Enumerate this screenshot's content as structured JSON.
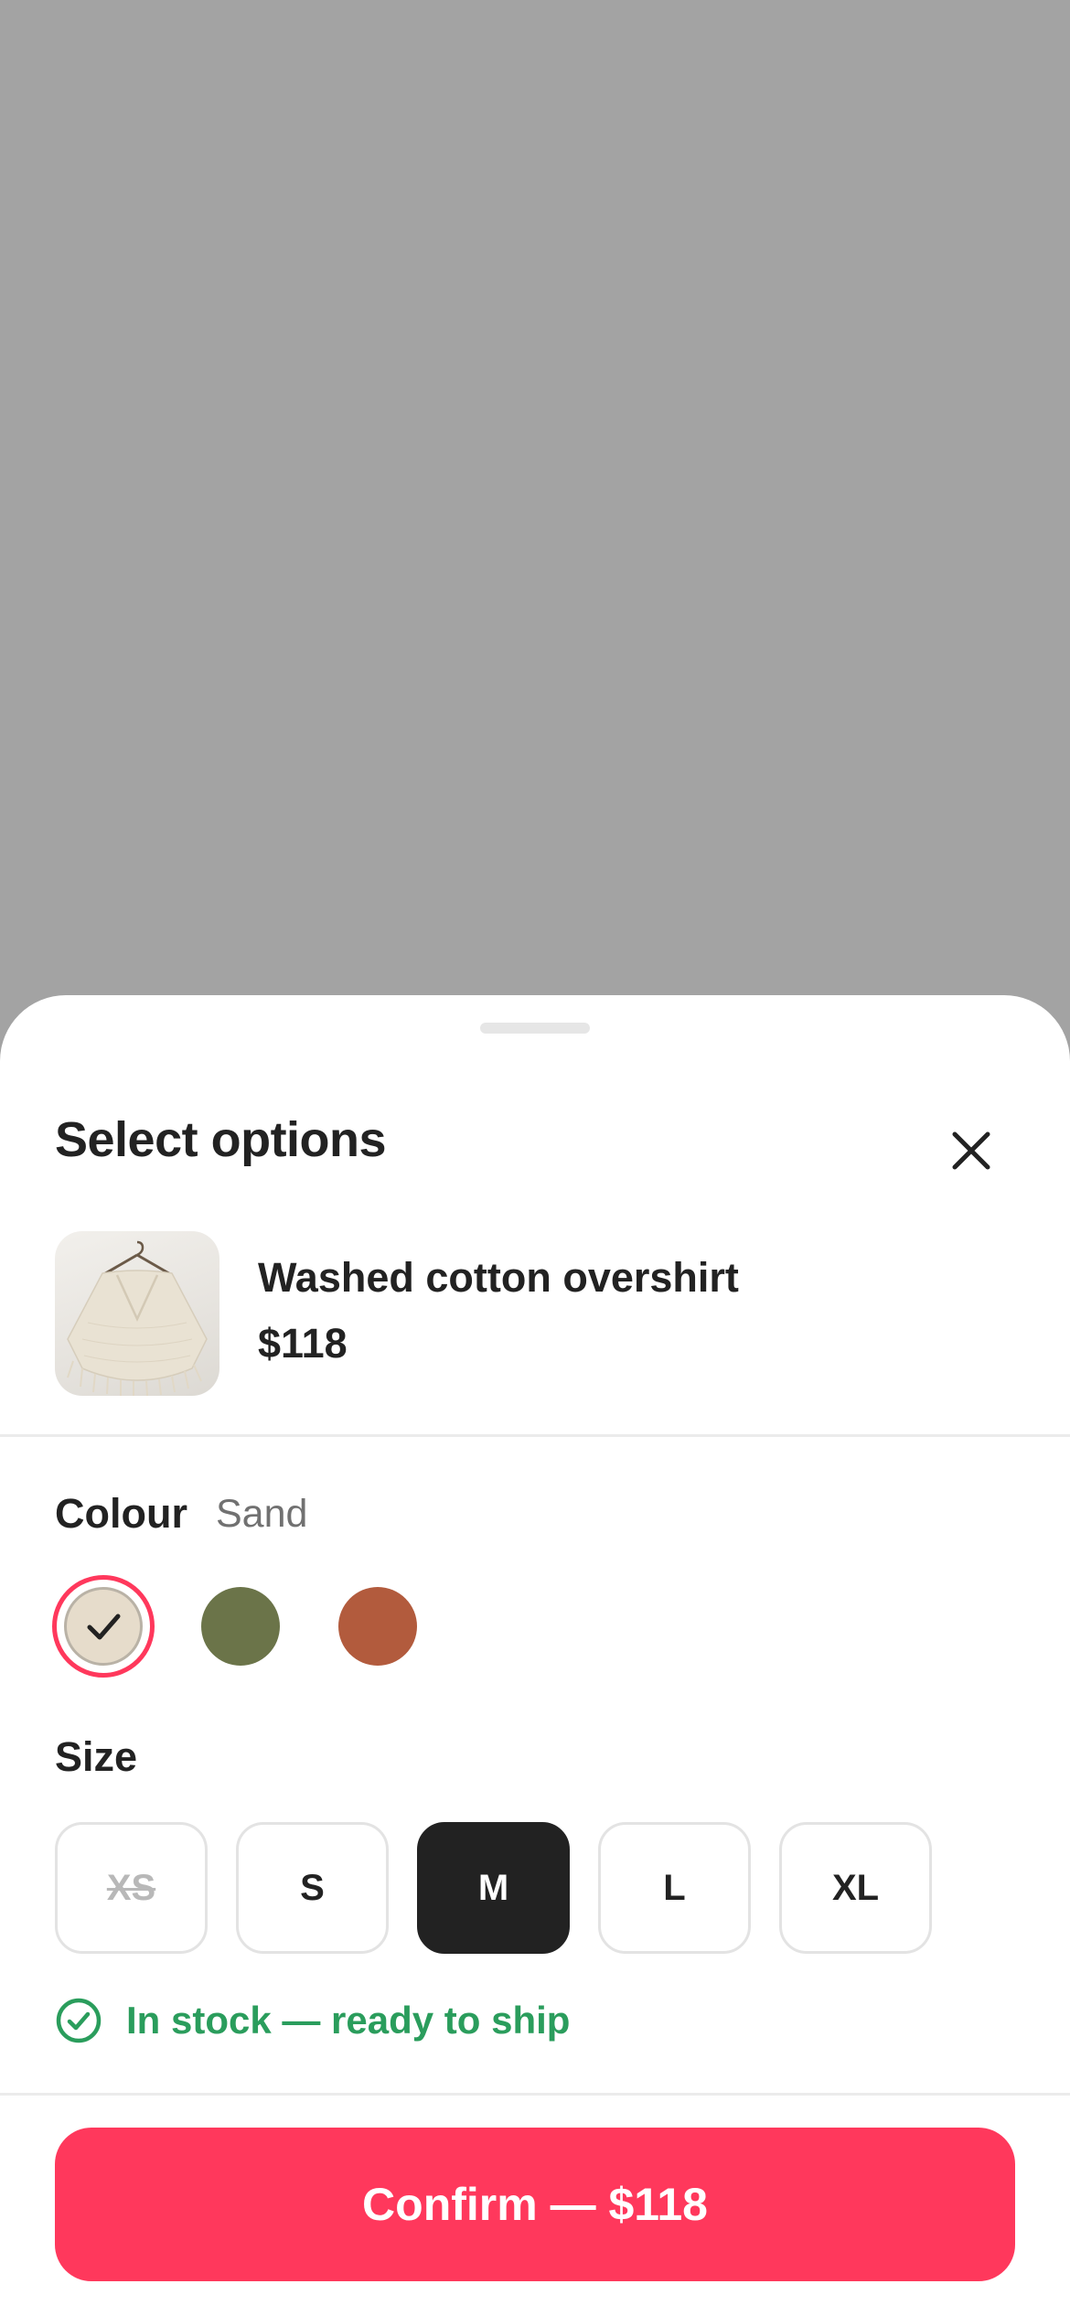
{
  "sheet": {
    "title": "Select options",
    "close_icon": "close-icon"
  },
  "product": {
    "name": "Washed cotton overshirt",
    "price": "$118"
  },
  "colour": {
    "label": "Colour",
    "selected_name": "Sand",
    "swatches": [
      {
        "color": "#e6dccb",
        "selected": true
      },
      {
        "color": "#6b7449",
        "selected": false
      },
      {
        "color": "#b25b3d",
        "selected": false
      }
    ],
    "selected_ring_color": "#ff385c"
  },
  "size": {
    "label": "Size",
    "options": [
      {
        "label": "XS",
        "state": "unavailable"
      },
      {
        "label": "S",
        "state": "available"
      },
      {
        "label": "M",
        "state": "selected"
      },
      {
        "label": "L",
        "state": "available"
      },
      {
        "label": "XL",
        "state": "available"
      }
    ]
  },
  "stock": {
    "text": "In stock — ready to ship",
    "icon": "check-circle-icon",
    "color": "#2a9d5c"
  },
  "confirm": {
    "label": "Confirm — $118",
    "color": "#ff385c"
  }
}
